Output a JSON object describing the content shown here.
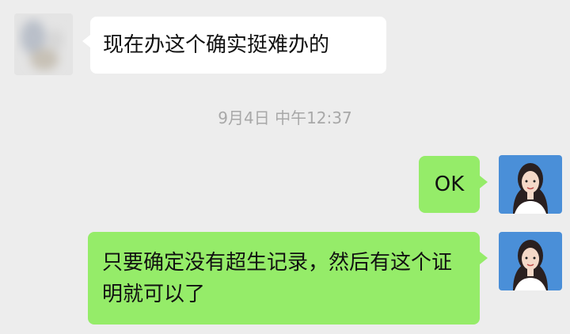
{
  "chat": {
    "messages": [
      {
        "side": "left",
        "text": "现在办这个确实挺难办的"
      },
      {
        "side": "right",
        "text": "OK"
      },
      {
        "side": "right",
        "text": "只要确定没有超生记录，然后有这个证明就可以了"
      }
    ],
    "timestamp": "9月4日 中午12:37"
  },
  "colors": {
    "background": "#ededed",
    "incoming_bubble": "#ffffff",
    "outgoing_bubble": "#95ec69",
    "timestamp_text": "#a8a8a8"
  },
  "icons": {
    "contact_avatar": "blurred-avatar-icon",
    "self_avatar": "user-avatar-photo"
  }
}
